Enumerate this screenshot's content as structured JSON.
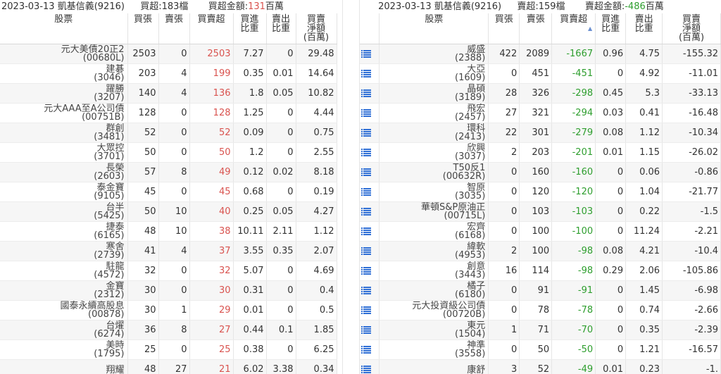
{
  "left": {
    "header": {
      "date": "2023-03-13",
      "broker": "凱基信義(9216)",
      "count_label": "買超:183檔",
      "amount_label": "買超金額:",
      "amount_value": "131",
      "amount_unit": "百萬"
    },
    "columns": [
      "股票",
      "買張",
      "賣張",
      "買賣超",
      "買進\n比重",
      "賣出\n比重",
      "買賣\n淨額\n(百萬)"
    ],
    "rows": [
      {
        "name": "元大美債20正2",
        "code": "(00680L)",
        "buy": "2503",
        "sell": "0",
        "net": "2503",
        "bratio": "7.27",
        "sratio": "0",
        "amount": "29.48"
      },
      {
        "name": "建碁",
        "code": "(3046)",
        "buy": "203",
        "sell": "4",
        "net": "199",
        "bratio": "0.35",
        "sratio": "0.01",
        "amount": "14.64"
      },
      {
        "name": "躍勝",
        "code": "(3207)",
        "buy": "140",
        "sell": "4",
        "net": "136",
        "bratio": "1.8",
        "sratio": "0.05",
        "amount": "10.82"
      },
      {
        "name": "元大AAA至A公司債",
        "code": "(00751B)",
        "buy": "128",
        "sell": "0",
        "net": "128",
        "bratio": "1.25",
        "sratio": "0",
        "amount": "4.44"
      },
      {
        "name": "群創",
        "code": "(3481)",
        "buy": "52",
        "sell": "0",
        "net": "52",
        "bratio": "0.09",
        "sratio": "0",
        "amount": "0.75"
      },
      {
        "name": "大眾控",
        "code": "(3701)",
        "buy": "50",
        "sell": "0",
        "net": "50",
        "bratio": "1.2",
        "sratio": "0",
        "amount": "2.55"
      },
      {
        "name": "長榮",
        "code": "(2603)",
        "buy": "57",
        "sell": "8",
        "net": "49",
        "bratio": "0.12",
        "sratio": "0.02",
        "amount": "8.18"
      },
      {
        "name": "泰金寶",
        "code": "(9105)",
        "buy": "45",
        "sell": "0",
        "net": "45",
        "bratio": "0.68",
        "sratio": "0",
        "amount": "0.19"
      },
      {
        "name": "台半",
        "code": "(5425)",
        "buy": "50",
        "sell": "10",
        "net": "40",
        "bratio": "0.25",
        "sratio": "0.05",
        "amount": "4.27"
      },
      {
        "name": "捷泰",
        "code": "(6165)",
        "buy": "48",
        "sell": "10",
        "net": "38",
        "bratio": "10.11",
        "sratio": "2.11",
        "amount": "1.12"
      },
      {
        "name": "寒舍",
        "code": "(2739)",
        "buy": "41",
        "sell": "4",
        "net": "37",
        "bratio": "3.55",
        "sratio": "0.35",
        "amount": "2.07"
      },
      {
        "name": "駐龍",
        "code": "(4572)",
        "buy": "32",
        "sell": "0",
        "net": "32",
        "bratio": "5.07",
        "sratio": "0",
        "amount": "4.69"
      },
      {
        "name": "金寶",
        "code": "(2312)",
        "buy": "30",
        "sell": "0",
        "net": "30",
        "bratio": "0.31",
        "sratio": "0",
        "amount": "0.4"
      },
      {
        "name": "國泰永續高股息",
        "code": "(00878)",
        "buy": "30",
        "sell": "1",
        "net": "29",
        "bratio": "0.01",
        "sratio": "0",
        "amount": "0.5"
      },
      {
        "name": "台燿",
        "code": "(6274)",
        "buy": "36",
        "sell": "8",
        "net": "27",
        "bratio": "0.44",
        "sratio": "0.1",
        "amount": "1.85"
      },
      {
        "name": "美時",
        "code": "(1795)",
        "buy": "25",
        "sell": "0",
        "net": "25",
        "bratio": "0.38",
        "sratio": "0",
        "amount": "6.25"
      },
      {
        "name": "翔耀",
        "code": "",
        "buy": "48",
        "sell": "27",
        "net": "21",
        "bratio": "6.02",
        "sratio": "3.38",
        "amount": "0.34"
      }
    ]
  },
  "right": {
    "header": {
      "date": "2023-03-13",
      "broker": "凱基信義(9216)",
      "count_label": "賣超:159檔",
      "amount_label": "賣超金額:",
      "amount_value": "-486",
      "amount_unit": "百萬"
    },
    "columns": [
      "",
      "股票",
      "買張",
      "賣張",
      "買賣超",
      "買進\n比重",
      "賣出\n比重",
      "買賣\n淨額\n(百萬)"
    ],
    "rows": [
      {
        "name": "威盛",
        "code": "(2388)",
        "buy": "422",
        "sell": "2089",
        "net": "-1667",
        "bratio": "0.96",
        "sratio": "4.75",
        "amount": "-155.32"
      },
      {
        "name": "大亞",
        "code": "(1609)",
        "buy": "0",
        "sell": "451",
        "net": "-451",
        "bratio": "0",
        "sratio": "4.92",
        "amount": "-11.01"
      },
      {
        "name": "晶碩",
        "code": "(3189)",
        "buy": "28",
        "sell": "326",
        "net": "-298",
        "bratio": "0.45",
        "sratio": "5.3",
        "amount": "-33.13"
      },
      {
        "name": "飛宏",
        "code": "(2457)",
        "buy": "27",
        "sell": "321",
        "net": "-294",
        "bratio": "0.03",
        "sratio": "0.41",
        "amount": "-16.48"
      },
      {
        "name": "環科",
        "code": "(2413)",
        "buy": "22",
        "sell": "301",
        "net": "-279",
        "bratio": "0.08",
        "sratio": "1.12",
        "amount": "-10.34"
      },
      {
        "name": "欣興",
        "code": "(3037)",
        "buy": "2",
        "sell": "203",
        "net": "-201",
        "bratio": "0.01",
        "sratio": "1.15",
        "amount": "-26.02"
      },
      {
        "name": "T50反1",
        "code": "(00632R)",
        "buy": "0",
        "sell": "160",
        "net": "-160",
        "bratio": "0",
        "sratio": "0.06",
        "amount": "-0.86"
      },
      {
        "name": "智原",
        "code": "(3035)",
        "buy": "0",
        "sell": "120",
        "net": "-120",
        "bratio": "0",
        "sratio": "1.04",
        "amount": "-21.77"
      },
      {
        "name": "華頓S&P原油正",
        "code": "(00715L)",
        "buy": "0",
        "sell": "103",
        "net": "-103",
        "bratio": "0",
        "sratio": "0.22",
        "amount": "-1.5"
      },
      {
        "name": "宏齊",
        "code": "(6168)",
        "buy": "0",
        "sell": "100",
        "net": "-100",
        "bratio": "0",
        "sratio": "11.24",
        "amount": "-2.21"
      },
      {
        "name": "緯軟",
        "code": "(4953)",
        "buy": "2",
        "sell": "100",
        "net": "-98",
        "bratio": "0.08",
        "sratio": "4.21",
        "amount": "-10.4"
      },
      {
        "name": "創意",
        "code": "(3443)",
        "buy": "16",
        "sell": "114",
        "net": "-98",
        "bratio": "0.29",
        "sratio": "2.06",
        "amount": "-105.86"
      },
      {
        "name": "橘子",
        "code": "(6180)",
        "buy": "0",
        "sell": "91",
        "net": "-91",
        "bratio": "0",
        "sratio": "1.45",
        "amount": "-6.98"
      },
      {
        "name": "元大投資級公司債",
        "code": "(00720B)",
        "buy": "0",
        "sell": "78",
        "net": "-78",
        "bratio": "0",
        "sratio": "0.74",
        "amount": "-2.66"
      },
      {
        "name": "東元",
        "code": "(1504)",
        "buy": "1",
        "sell": "71",
        "net": "-70",
        "bratio": "0",
        "sratio": "0.35",
        "amount": "-2.39"
      },
      {
        "name": "神準",
        "code": "(3558)",
        "buy": "0",
        "sell": "50",
        "net": "-50",
        "bratio": "0",
        "sratio": "1.21",
        "amount": "-16.57"
      },
      {
        "name": "康舒",
        "code": "",
        "buy": "3",
        "sell": "52",
        "net": "-49",
        "bratio": "0.01",
        "sratio": "0.23",
        "amount": "-1."
      }
    ]
  },
  "colors": {
    "positive": "#d9534f",
    "negative": "#2e9e2e",
    "list_icon": "#2f6fd6"
  },
  "icons": {
    "row_icon": "list-icon",
    "sort_icon": "sort-triangle-icon"
  }
}
